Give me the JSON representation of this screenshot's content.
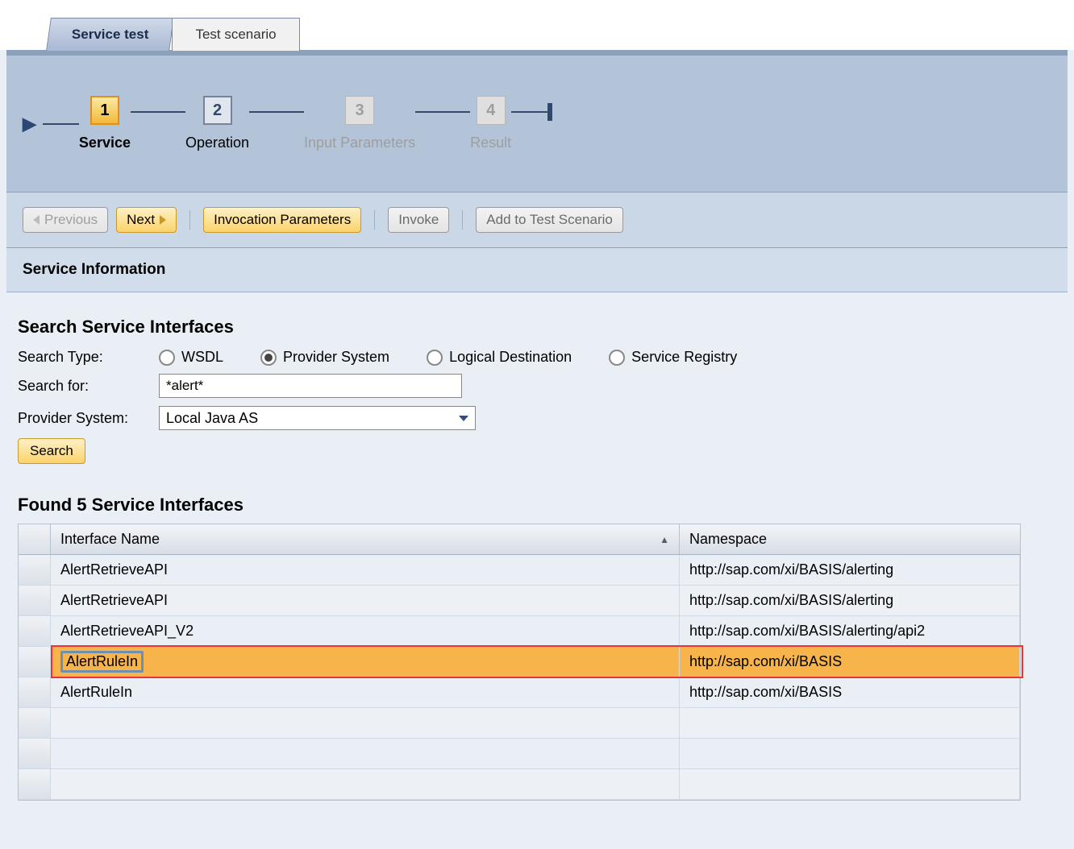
{
  "tabs": {
    "service_test": "Service test",
    "test_scenario": "Test scenario"
  },
  "roadmap": {
    "steps": [
      {
        "num": "1",
        "label": "Service"
      },
      {
        "num": "2",
        "label": "Operation"
      },
      {
        "num": "3",
        "label": "Input Parameters"
      },
      {
        "num": "4",
        "label": "Result"
      }
    ]
  },
  "toolbar": {
    "previous": "Previous",
    "next": "Next",
    "invocation_parameters": "Invocation Parameters",
    "invoke": "Invoke",
    "add_to_test_scenario": "Add to Test Scenario"
  },
  "section": {
    "service_information": "Service Information"
  },
  "search": {
    "title": "Search Service Interfaces",
    "type_label": "Search Type:",
    "radios": {
      "wsdl": "WSDL",
      "provider_system": "Provider System",
      "logical_destination": "Logical Destination",
      "service_registry": "Service Registry"
    },
    "search_for_label": "Search for:",
    "search_for_value": "*alert*",
    "provider_system_label": "Provider System:",
    "provider_system_value": "Local Java AS",
    "search_button": "Search"
  },
  "results": {
    "title": "Found 5 Service Interfaces",
    "columns": {
      "interface_name": "Interface Name",
      "namespace": "Namespace"
    },
    "rows": [
      {
        "name": "AlertRetrieveAPI",
        "ns": "http://sap.com/xi/BASIS/alerting"
      },
      {
        "name": "AlertRetrieveAPI",
        "ns": "http://sap.com/xi/BASIS/alerting"
      },
      {
        "name": "AlertRetrieveAPI_V2",
        "ns": "http://sap.com/xi/BASIS/alerting/api2"
      },
      {
        "name": "AlertRuleIn",
        "ns": "http://sap.com/xi/BASIS"
      },
      {
        "name": "AlertRuleIn",
        "ns": "http://sap.com/xi/BASIS"
      }
    ]
  }
}
